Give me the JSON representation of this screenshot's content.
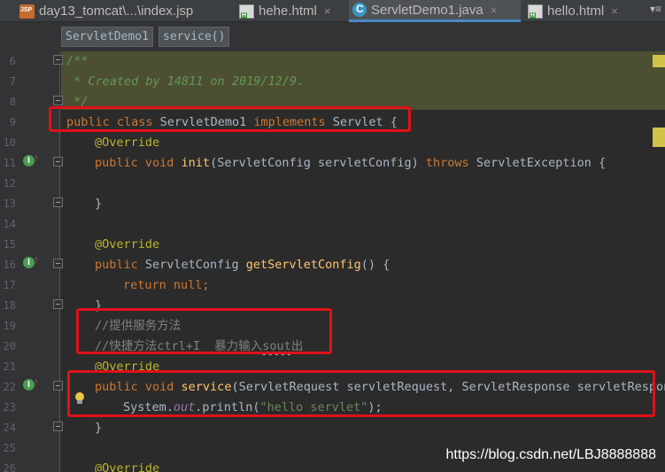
{
  "tabs": [
    {
      "label": "day13_tomcat\\...\\index.jsp",
      "icon": "jsp-file-icon",
      "active": false
    },
    {
      "label": "hehe.html",
      "icon": "html-file-icon",
      "active": false
    },
    {
      "label": "ServletDemo1.java",
      "icon": "java-class-icon",
      "active": true
    },
    {
      "label": "hello.html",
      "icon": "html-file-icon",
      "active": false
    }
  ],
  "tab_close": "×",
  "tab_menu": "▾≡",
  "breadcrumb": {
    "class_name": "ServletDemo1",
    "method_name": "service()"
  },
  "line_numbers": [
    "6",
    "7",
    "8",
    "9",
    "10",
    "11",
    "12",
    "13",
    "14",
    "15",
    "16",
    "17",
    "18",
    "19",
    "20",
    "21",
    "22",
    "23",
    "24",
    "25",
    "26"
  ],
  "code": {
    "l6": "/**",
    "l7": " * Created by 14811 on 2019/12/9.",
    "l8": " */",
    "l9_kw1": "public class ",
    "l9_name": "ServletDemo1 ",
    "l9_kw2": "implements ",
    "l9_rest": "Servlet {",
    "l10": "@Override",
    "l11_kw": "public void ",
    "l11_fn": "init",
    "l11_params": "(ServletConfig servletConfig) ",
    "l11_throws": "throws ",
    "l11_rest": "ServletException {",
    "l13": "}",
    "l15": "@Override",
    "l16_kw": "public ",
    "l16_type": "ServletConfig ",
    "l16_fn": "getServletConfig",
    "l16_rest": "() {",
    "l17_kw": "return null",
    "l17_rest": ";",
    "l18": "}",
    "l19": "//提供服务方法",
    "l20_a": "//快捷方法ctrl+I  暴力输入",
    "l20_b": "sout",
    "l20_c": "出",
    "l21": "@Override",
    "l22_kw": "public void ",
    "l22_fn": "service",
    "l22_rest": "(ServletRequest servletRequest, ServletResponse servletResponse",
    "l23_a": "System.",
    "l23_field": "out",
    "l23_b": ".println(",
    "l23_str": "\"hello servlet\"",
    "l23_c": ");",
    "l24": "}",
    "l26": "@Override"
  },
  "gutter_icons": {
    "implements": "I",
    "arrow": "↑"
  },
  "watermark": "https://blog.csdn.net/LBJ8888888",
  "colors": {
    "highlight_box": "#e0111a",
    "keyword": "#cc7832",
    "annotation": "#bbb529",
    "method": "#ffc66d",
    "comment": "#808080"
  }
}
